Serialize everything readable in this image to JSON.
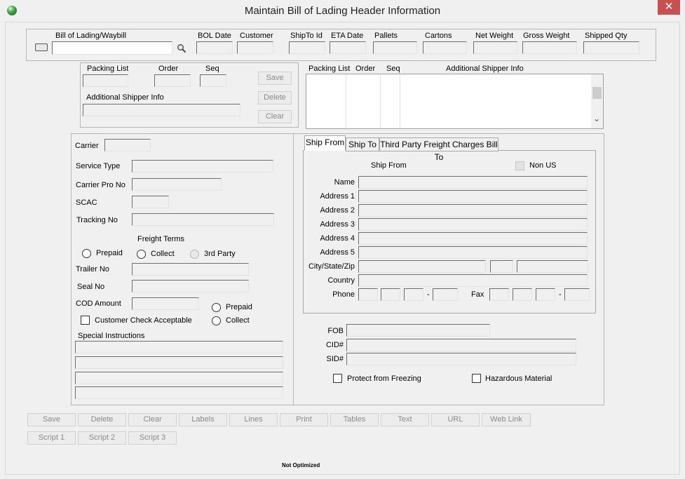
{
  "window": {
    "title": "Maintain Bill of Lading Header Information",
    "close_glyph": "✕"
  },
  "header": {
    "bol_label": "Bill of Lading/Waybill",
    "bol_value": "",
    "columns": [
      "BOL Date",
      "Customer",
      "ShipTo Id",
      "ETA Date",
      "Pallets",
      "Cartons",
      "Net Weight",
      "Gross Weight",
      "Shipped Qty"
    ]
  },
  "packing": {
    "packing_list_label": "Packing List",
    "order_label": "Order",
    "seq_label": "Seq",
    "additional_label": "Additional Shipper Info",
    "save": "Save",
    "delete": "Delete",
    "clear": "Clear",
    "list_columns": [
      "Packing List",
      "Order",
      "Seq",
      "Additional Shipper Info"
    ],
    "scroll_down": "⌄"
  },
  "carrier": {
    "carrier": "Carrier",
    "service_type": "Service Type",
    "carrier_pro_no": "Carrier Pro No",
    "scac": "SCAC",
    "tracking_no": "Tracking No",
    "freight_terms": "Freight Terms",
    "prepaid": "Prepaid",
    "collect": "Collect",
    "third_party": "3rd Party",
    "trailer_no": "Trailer No",
    "seal_no": "Seal No",
    "cod_amount": "COD Amount",
    "cod_prepaid": "Prepaid",
    "cod_collect": "Collect",
    "customer_check": "Customer Check Acceptable",
    "special_instructions": "Special Instructions"
  },
  "tabs": [
    "Ship From",
    "Ship To",
    "Third Party Freight Charges Bill To"
  ],
  "ship_from": {
    "heading": "Ship From",
    "non_us": "Non US",
    "name": "Name",
    "address1": "Address 1",
    "address2": "Address 2",
    "address3": "Address 3",
    "address4": "Address 4",
    "address5": "Address 5",
    "city_state_zip": "City/State/Zip",
    "country": "Country",
    "phone": "Phone",
    "fax": "Fax",
    "dash": "-"
  },
  "extra": {
    "fob": "FOB",
    "cid": "CID#",
    "sid": "SID#",
    "protect_freezing": "Protect from Freezing",
    "hazardous": "Hazardous Material"
  },
  "toolbar": {
    "row1": [
      "Save",
      "Delete",
      "Clear",
      "Labels",
      "Lines",
      "Print",
      "Tables",
      "Text",
      "URL",
      "Web Link"
    ],
    "row2": [
      "Script 1",
      "Script 2",
      "Script 3"
    ]
  },
  "status": "Not Optimized"
}
